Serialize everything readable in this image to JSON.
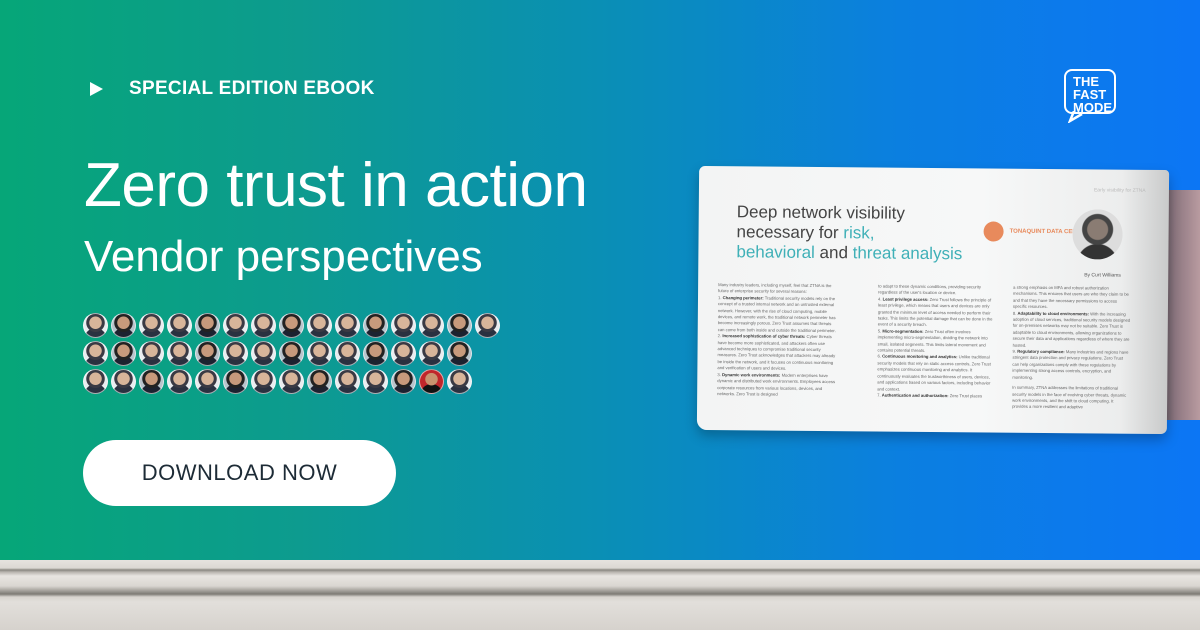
{
  "kicker": "SPECIAL EDITION EBOOK",
  "title": "Zero trust in action",
  "subtitle": "Vendor perspectives",
  "cta_label": "DOWNLOAD NOW",
  "logo": {
    "line1": "THE",
    "line2": "FAST",
    "line3": "MODE"
  },
  "avatar_rows": [
    15,
    14,
    14
  ],
  "colors": {
    "gradient_start": "#06a678",
    "gradient_end": "#0c76f5",
    "accent": "#3fb0b7"
  },
  "ebook_page": {
    "running_head": "Early visibility for ZTNA",
    "heading_plain_1": "Deep network visibility",
    "heading_plain_2": "necessary for ",
    "heading_hl_1": "risk,",
    "heading_hl_2": "behavioral",
    "heading_plain_3": " and ",
    "heading_hl_3": "threat analysis",
    "org_name": "TONAQUINT DATA CENTERS",
    "byline": "By Curt Williams",
    "col1_intro": "Many industry leaders, including myself, feel that ZTNA is the future of enterprise security for several reasons:",
    "col1_item1_title": "Changing perimeter:",
    "col1_item1": " Traditional security models rely on the concept of a trusted internal network and an untrusted external network. However, with the rise of cloud computing, mobile devices, and remote work, the traditional network perimeter has become increasingly porous. Zero Trust assumes that threats can come from both inside and outside the traditional perimeter.",
    "col1_item2_title": "Increased sophistication of cyber threats:",
    "col1_item2": " Cyber threats have become more sophisticated, and attackers often use advanced techniques to compromise traditional security measures. Zero Trust acknowledges that attackers may already be inside the network, and it focuses on continuous monitoring and verification of users and devices.",
    "col1_item3_title": "Dynamic work environments:",
    "col1_item3": " Modern enterprises have dynamic and distributed work environments. Employees access corporate resources from various locations, devices, and networks. Zero Trust is designed",
    "col2_intro": "to adapt to these dynamic conditions, providing security regardless of the user's location or device.",
    "col2_item4_title": "Least privilege access:",
    "col2_item4": " Zero Trust follows the principle of least privilege, which means that users and devices are only granted the minimum level of access needed to perform their tasks. This limits the potential damage that can be done in the event of a security breach.",
    "col2_item5_title": "Micro-segmentation:",
    "col2_item5": " Zero Trust often involves implementing micro-segmentation, dividing the network into small, isolated segments. This limits lateral movement and contains potential threats.",
    "col2_item6_title": "Continuous monitoring and analytics:",
    "col2_item6": " Unlike traditional security models that rely on static access controls, Zero Trust emphasizes continuous monitoring and analytics. It continuously evaluates the trustworthiness of users, devices, and applications based on various factors, including behavior and context.",
    "col2_item7_title": "Authentication and authorization:",
    "col2_item7": " Zero Trust places",
    "col3_intro": "a strong emphasis on MFA and robust authorization mechanisms. This ensures that users are who they claim to be and that they have the necessary permissions to access specific resources.",
    "col3_item8_title": "Adaptability to cloud environments:",
    "col3_item8": " With the increasing adoption of cloud services, traditional security models designed for on-premises networks may not be suitable. Zero Trust is adaptable to cloud environments, allowing organizations to secure their data and applications regardless of where they are hosted.",
    "col3_item9_title": "Regulatory compliance:",
    "col3_item9": " Many industries and regions have stringent data protection and privacy regulations. Zero Trust can help organizations comply with these regulations by implementing strong access controls, encryption, and monitoring.",
    "col3_summary": "In summary, ZTNA addresses the limitations of traditional security models in the face of evolving cyber threats, dynamic work environments, and the shift to cloud computing. It provides a more resilient and adaptive"
  }
}
